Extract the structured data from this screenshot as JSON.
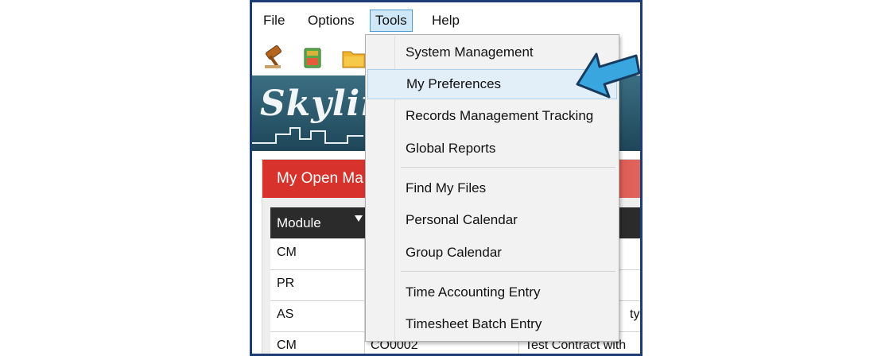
{
  "menubar": {
    "items": [
      {
        "label": "File"
      },
      {
        "label": "Options"
      },
      {
        "label": "Tools"
      },
      {
        "label": "Help"
      }
    ]
  },
  "banner": {
    "text": "Skyline"
  },
  "panel": {
    "title": "My Open Ma",
    "columns": [
      "Module"
    ],
    "rows": [
      {
        "module": "CM",
        "col2": "",
        "col3": ""
      },
      {
        "module": "PR",
        "col2": "",
        "col3": ""
      },
      {
        "module": "AS",
        "col2": "",
        "col3": "ty D"
      },
      {
        "module": "CM",
        "col2": "CO0002",
        "col3": "Test Contract with"
      }
    ]
  },
  "tools_menu": {
    "items": [
      {
        "label": "System Management"
      },
      {
        "label": "My Preferences"
      },
      {
        "label": "Records Management Tracking"
      },
      {
        "label": "Global Reports"
      },
      {
        "label": "Find My Files"
      },
      {
        "label": "Personal Calendar"
      },
      {
        "label": "Group Calendar"
      },
      {
        "label": "Time Accounting Entry"
      },
      {
        "label": "Timesheet Batch Entry"
      }
    ],
    "highlighted": "My Preferences"
  },
  "colors": {
    "frame_border": "#1f3b73",
    "panel_header": "#d7322c",
    "menu_highlight": "#e2eef8",
    "active_menu": "#cfe8f7",
    "callout_arrow": "#3aa6e0"
  },
  "icons": [
    "gavel-icon",
    "book-icon",
    "folder-icon",
    "arrow-pointer-icon",
    "filter-icon"
  ]
}
